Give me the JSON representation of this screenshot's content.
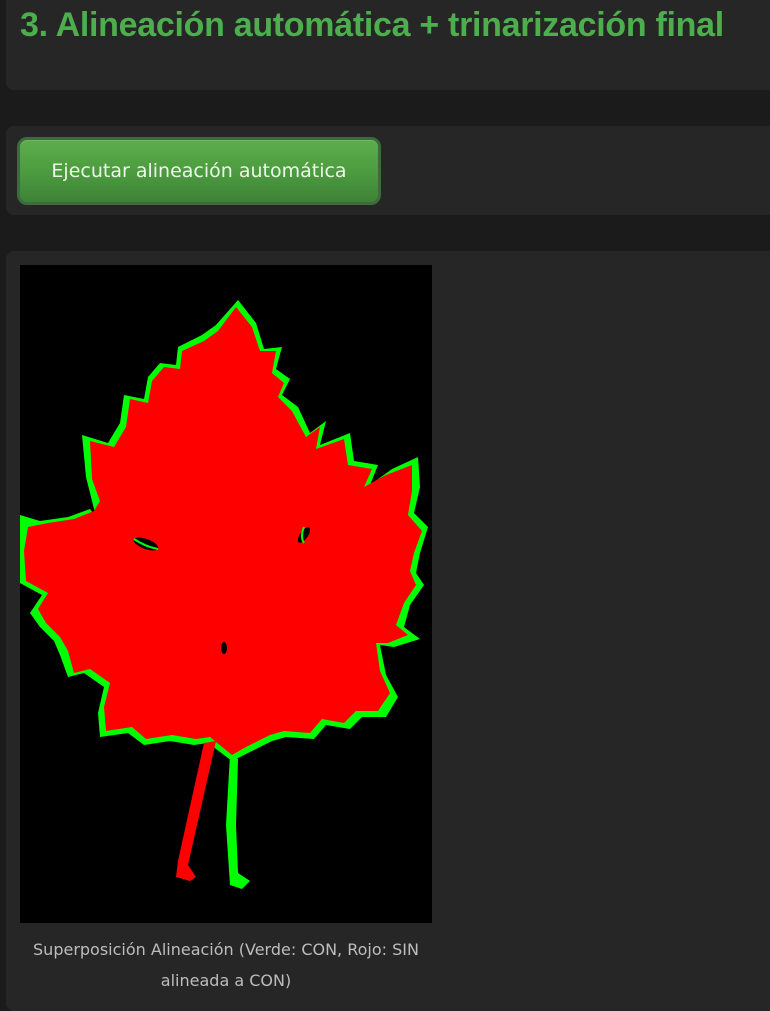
{
  "section": {
    "title": "3. Alineación automática + trinarización final"
  },
  "actions": {
    "run_alignment_label": "Ejecutar alineación automática"
  },
  "result": {
    "caption": "Superposición Alineación (Verde: CON, Rojo: SIN alineada a CON)",
    "overlay_colors": {
      "con": "#00ff00",
      "sin": "#ff0000",
      "background": "#000000"
    }
  },
  "theme": {
    "accent": "#4cae4c",
    "panel": "#262626",
    "page": "#1b1b1b"
  }
}
